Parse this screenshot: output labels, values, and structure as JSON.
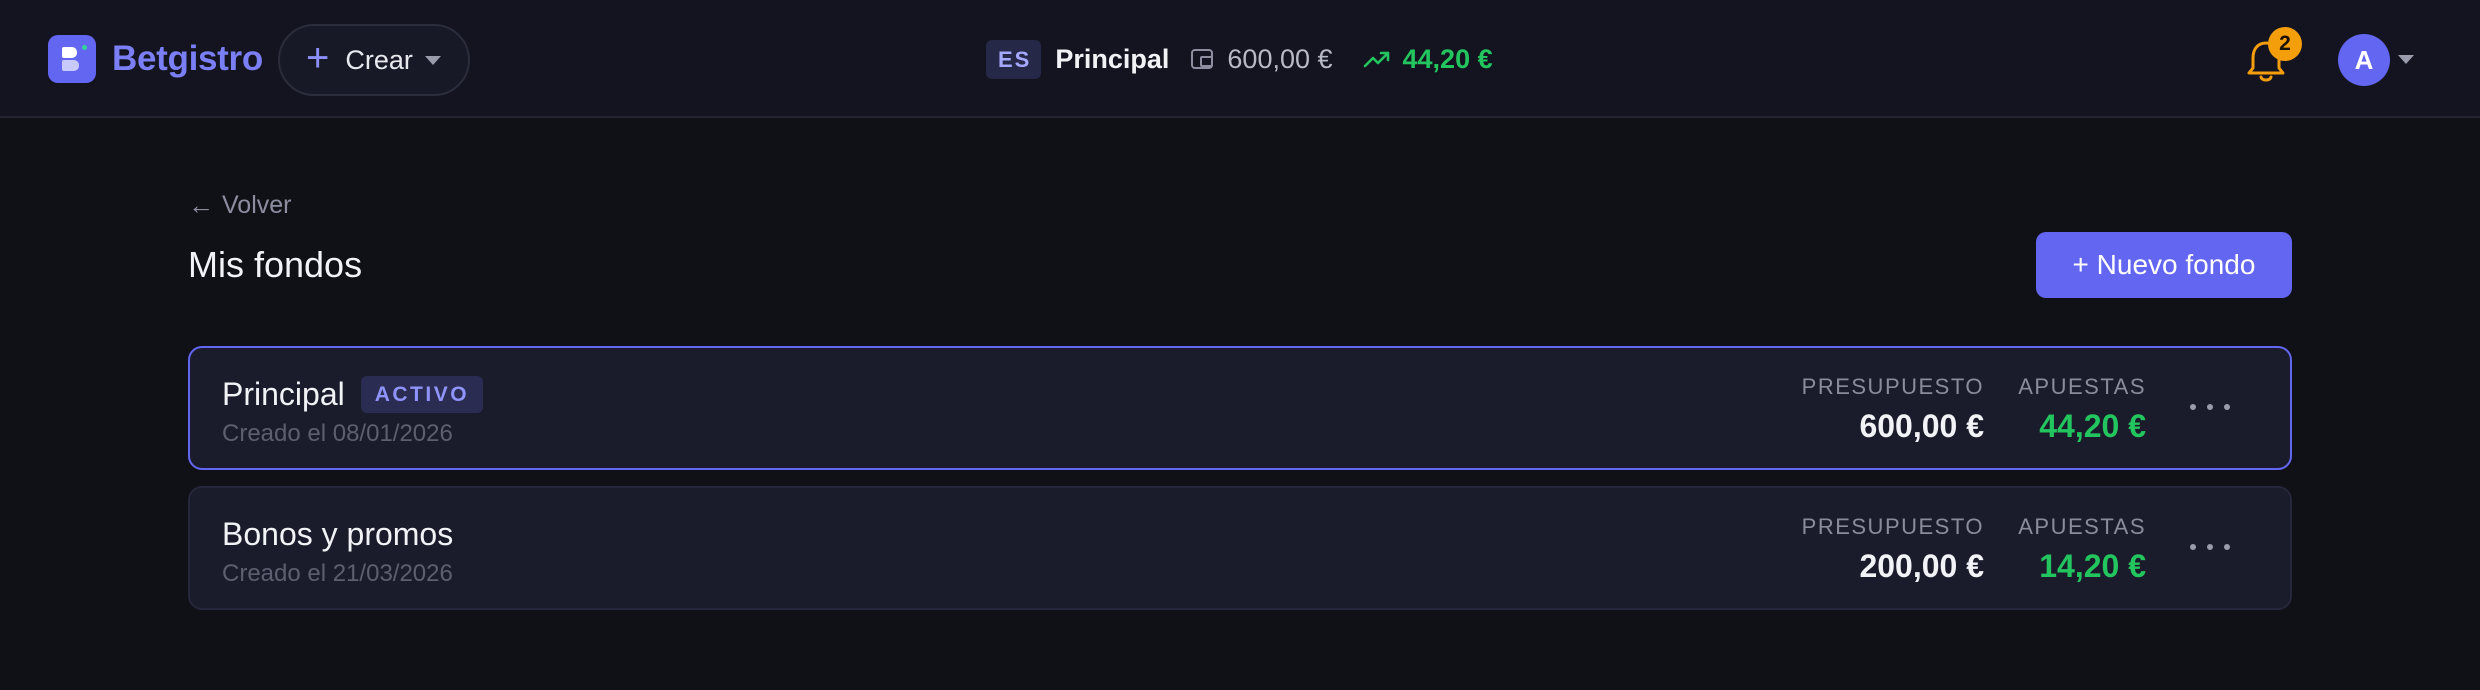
{
  "header": {
    "brand_name": "Betgistro",
    "create_label": "Crear",
    "language_code": "ES",
    "current_fund": "Principal",
    "budget": "600,00 €",
    "bets_total": "44,20 €",
    "notification_count": "2",
    "avatar_initial": "A"
  },
  "page": {
    "back_label": "Volver",
    "title": "Mis fondos",
    "new_fund_label": "+ Nuevo fondo"
  },
  "funds": [
    {
      "name": "Principal",
      "badge": "ACTIVO",
      "created": "Creado el 08/01/2026",
      "budget_label": "PRESUPUESTO",
      "budget": "600,00 €",
      "bets_label": "APUESTAS",
      "bets": "44,20 €"
    },
    {
      "name": "Bonos y promos",
      "created": "Creado el 21/03/2026",
      "budget_label": "PRESUPUESTO",
      "budget": "200,00 €",
      "bets_label": "APUESTAS",
      "bets": "14,20 €"
    }
  ],
  "colors": {
    "accent": "#6366f1",
    "positive": "#22c55e",
    "notification": "#f59e0b",
    "background": "#101117"
  },
  "icons": {
    "logo": "betgistro-logo-icon",
    "create": "plus-icon",
    "wallet": "wallet-icon",
    "trend": "trending-up-icon",
    "notifications": "bell-icon",
    "back": "arrow-left-icon",
    "more": "more-horizontal-icon"
  }
}
